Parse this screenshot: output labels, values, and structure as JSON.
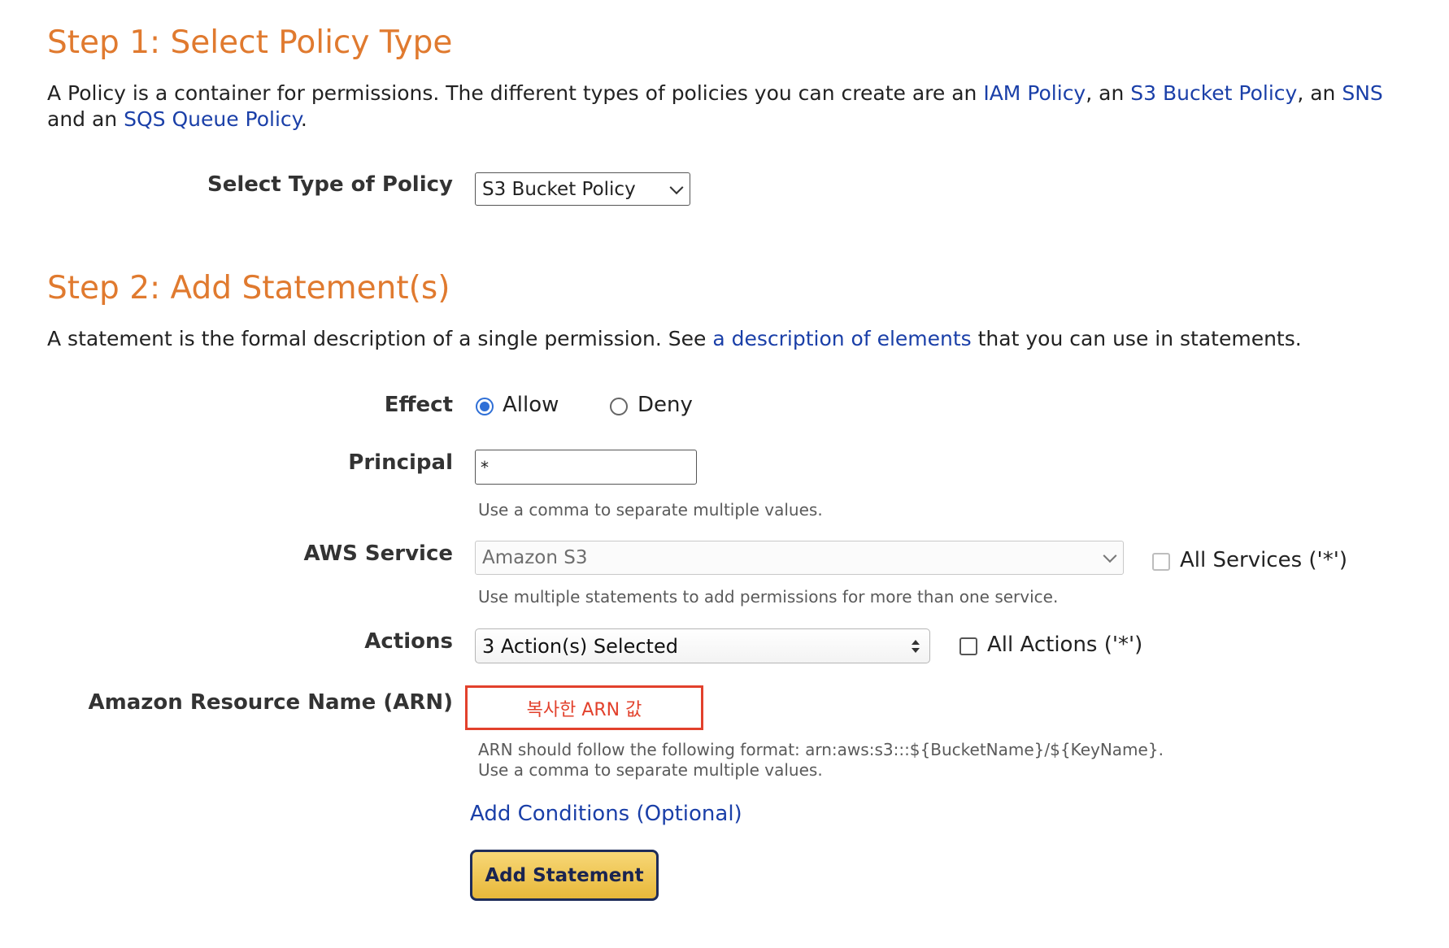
{
  "step1": {
    "heading": "Step 1: Select Policy Type",
    "intro_line1_prefix": "A Policy is a container for permissions. The different types of policies you can create are an ",
    "link_iam": "IAM Policy",
    "sep1": ", an ",
    "link_s3": "S3 Bucket Policy",
    "sep2": ", an ",
    "link_sns": "SNS",
    "intro_line2_prefix": "and an ",
    "link_sqs": "SQS Queue Policy",
    "intro_line2_suffix": ".",
    "type_label": "Select Type of Policy",
    "type_value": "S3 Bucket Policy"
  },
  "step2": {
    "heading": "Step 2: Add Statement(s)",
    "intro_prefix": "A statement is the formal description of a single permission. See ",
    "intro_link": "a description of elements",
    "intro_suffix": " that you can use in statements.",
    "effect": {
      "label": "Effect",
      "options": [
        {
          "label": "Allow",
          "checked": true
        },
        {
          "label": "Deny",
          "checked": false
        }
      ]
    },
    "principal": {
      "label": "Principal",
      "value": "*",
      "hint": "Use a comma to separate multiple values."
    },
    "aws_service": {
      "label": "AWS Service",
      "value": "Amazon S3",
      "all_label": "All Services ('*')",
      "all_checked": false,
      "hint": "Use multiple statements to add permissions for more than one service."
    },
    "actions": {
      "label": "Actions",
      "value": "3 Action(s) Selected",
      "all_label": "All Actions ('*')",
      "all_checked": false
    },
    "arn": {
      "label": "Amazon Resource Name (ARN)",
      "value": "복사한 ARN 값",
      "hint_line1": "ARN should follow the following format: arn:aws:s3:::${BucketName}/${KeyName}.",
      "hint_line2": "Use a comma to separate multiple values.",
      "highlight_color": "#e2412c"
    },
    "add_conditions": "Add Conditions (Optional)",
    "add_statement_button": "Add Statement"
  },
  "colors": {
    "heading": "#e07a2f",
    "link": "#1a3fa8",
    "radio_accent": "#2f6fd6",
    "button_fill": "#e8b83a",
    "button_border": "#1e2c5a"
  }
}
